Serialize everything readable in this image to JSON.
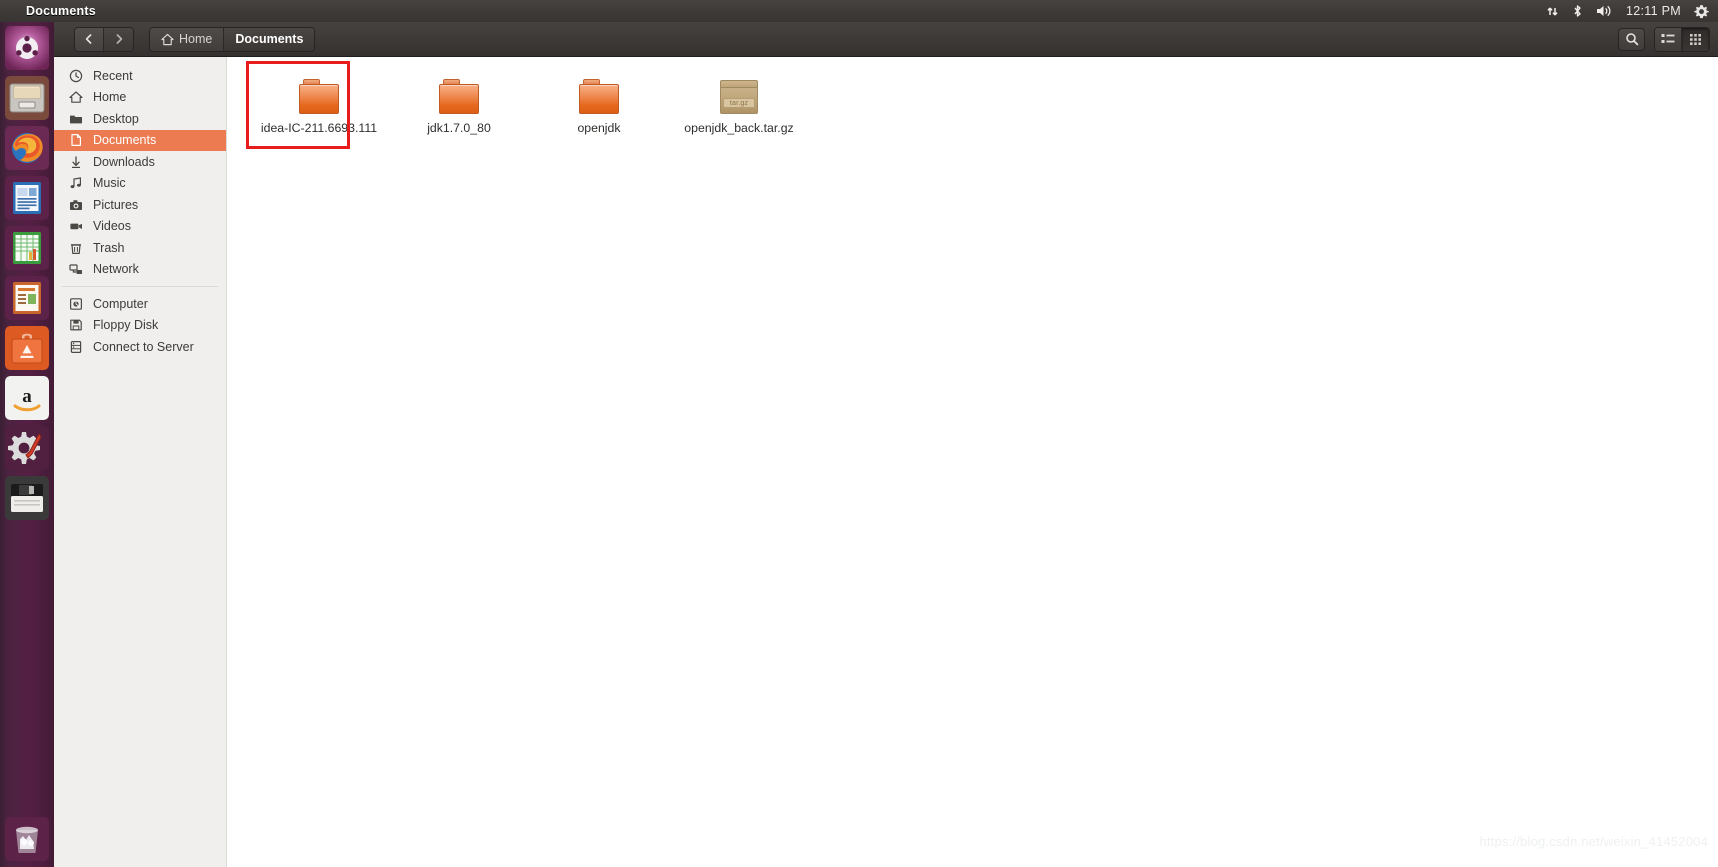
{
  "panel": {
    "app_title": "Documents",
    "tray": {
      "network_icon": "network-updown-icon",
      "bluetooth_icon": "bluetooth-icon",
      "volume_icon": "volume-icon",
      "clock": "12:11 PM",
      "settings_icon": "gear-icon"
    }
  },
  "launcher": {
    "items": [
      {
        "name": "ubuntu-dash",
        "label": "Dash home",
        "icon": "ubuntu-logo-icon",
        "active": false
      },
      {
        "name": "files",
        "label": "Files",
        "icon": "file-manager-icon",
        "active": true
      },
      {
        "name": "firefox",
        "label": "Firefox Web Browser",
        "icon": "firefox-icon",
        "active": false
      },
      {
        "name": "writer",
        "label": "LibreOffice Writer",
        "icon": "document-icon",
        "active": false
      },
      {
        "name": "calc",
        "label": "LibreOffice Calc",
        "icon": "spreadsheet-icon",
        "active": false
      },
      {
        "name": "impress",
        "label": "LibreOffice Impress",
        "icon": "presentation-icon",
        "active": false
      },
      {
        "name": "software-center",
        "label": "Ubuntu Software",
        "icon": "software-bag-icon",
        "active": false
      },
      {
        "name": "amazon",
        "label": "Amazon",
        "icon": "amazon-icon",
        "active": false
      },
      {
        "name": "system-settings",
        "label": "System Settings",
        "icon": "gear-wrench-icon",
        "active": false
      },
      {
        "name": "floppy-drive",
        "label": "Floppy Disk",
        "icon": "floppy-disk-icon",
        "active": false
      }
    ],
    "trash": {
      "label": "Trash",
      "icon": "trash-icon"
    }
  },
  "toolbar": {
    "back_label": "Back",
    "forward_label": "Forward",
    "breadcrumbs": [
      {
        "label": "Home",
        "icon": "home-icon",
        "active": false
      },
      {
        "label": "Documents",
        "icon": "",
        "active": true
      }
    ],
    "search_label": "Search",
    "list_view_label": "List view",
    "grid_view_label": "Icon view",
    "active_view": "grid"
  },
  "sidebar": {
    "items": [
      {
        "label": "Recent",
        "icon": "clock-icon",
        "selected": false
      },
      {
        "label": "Home",
        "icon": "home-icon",
        "selected": false
      },
      {
        "label": "Desktop",
        "icon": "folder-icon",
        "selected": false
      },
      {
        "label": "Documents",
        "icon": "document-icon",
        "selected": true
      },
      {
        "label": "Downloads",
        "icon": "download-arrow-icon",
        "selected": false
      },
      {
        "label": "Music",
        "icon": "music-note-icon",
        "selected": false
      },
      {
        "label": "Pictures",
        "icon": "camera-icon",
        "selected": false
      },
      {
        "label": "Videos",
        "icon": "video-camera-icon",
        "selected": false
      },
      {
        "label": "Trash",
        "icon": "trash-icon",
        "selected": false
      },
      {
        "label": "Network",
        "icon": "network-icon",
        "selected": false
      }
    ],
    "devices": [
      {
        "label": "Computer",
        "icon": "computer-icon",
        "selected": false
      },
      {
        "label": "Floppy Disk",
        "icon": "floppy-disk-icon",
        "selected": false
      },
      {
        "label": "Connect to Server",
        "icon": "server-connect-icon",
        "selected": false
      }
    ]
  },
  "content": {
    "files": [
      {
        "name": "idea-IC-211.6693.111",
        "type": "folder",
        "badge": "",
        "highlighted": true
      },
      {
        "name": "jdk1.7.0_80",
        "type": "folder",
        "badge": "",
        "highlighted": false
      },
      {
        "name": "openjdk",
        "type": "folder",
        "badge": "",
        "highlighted": false
      },
      {
        "name": "openjdk_back.tar.gz",
        "type": "archive",
        "badge": "tar.gz",
        "highlighted": false
      }
    ],
    "annotation_color": "#e81c1c"
  },
  "watermark": {
    "text": "https://blog.csdn.net/weixin_41452004"
  }
}
